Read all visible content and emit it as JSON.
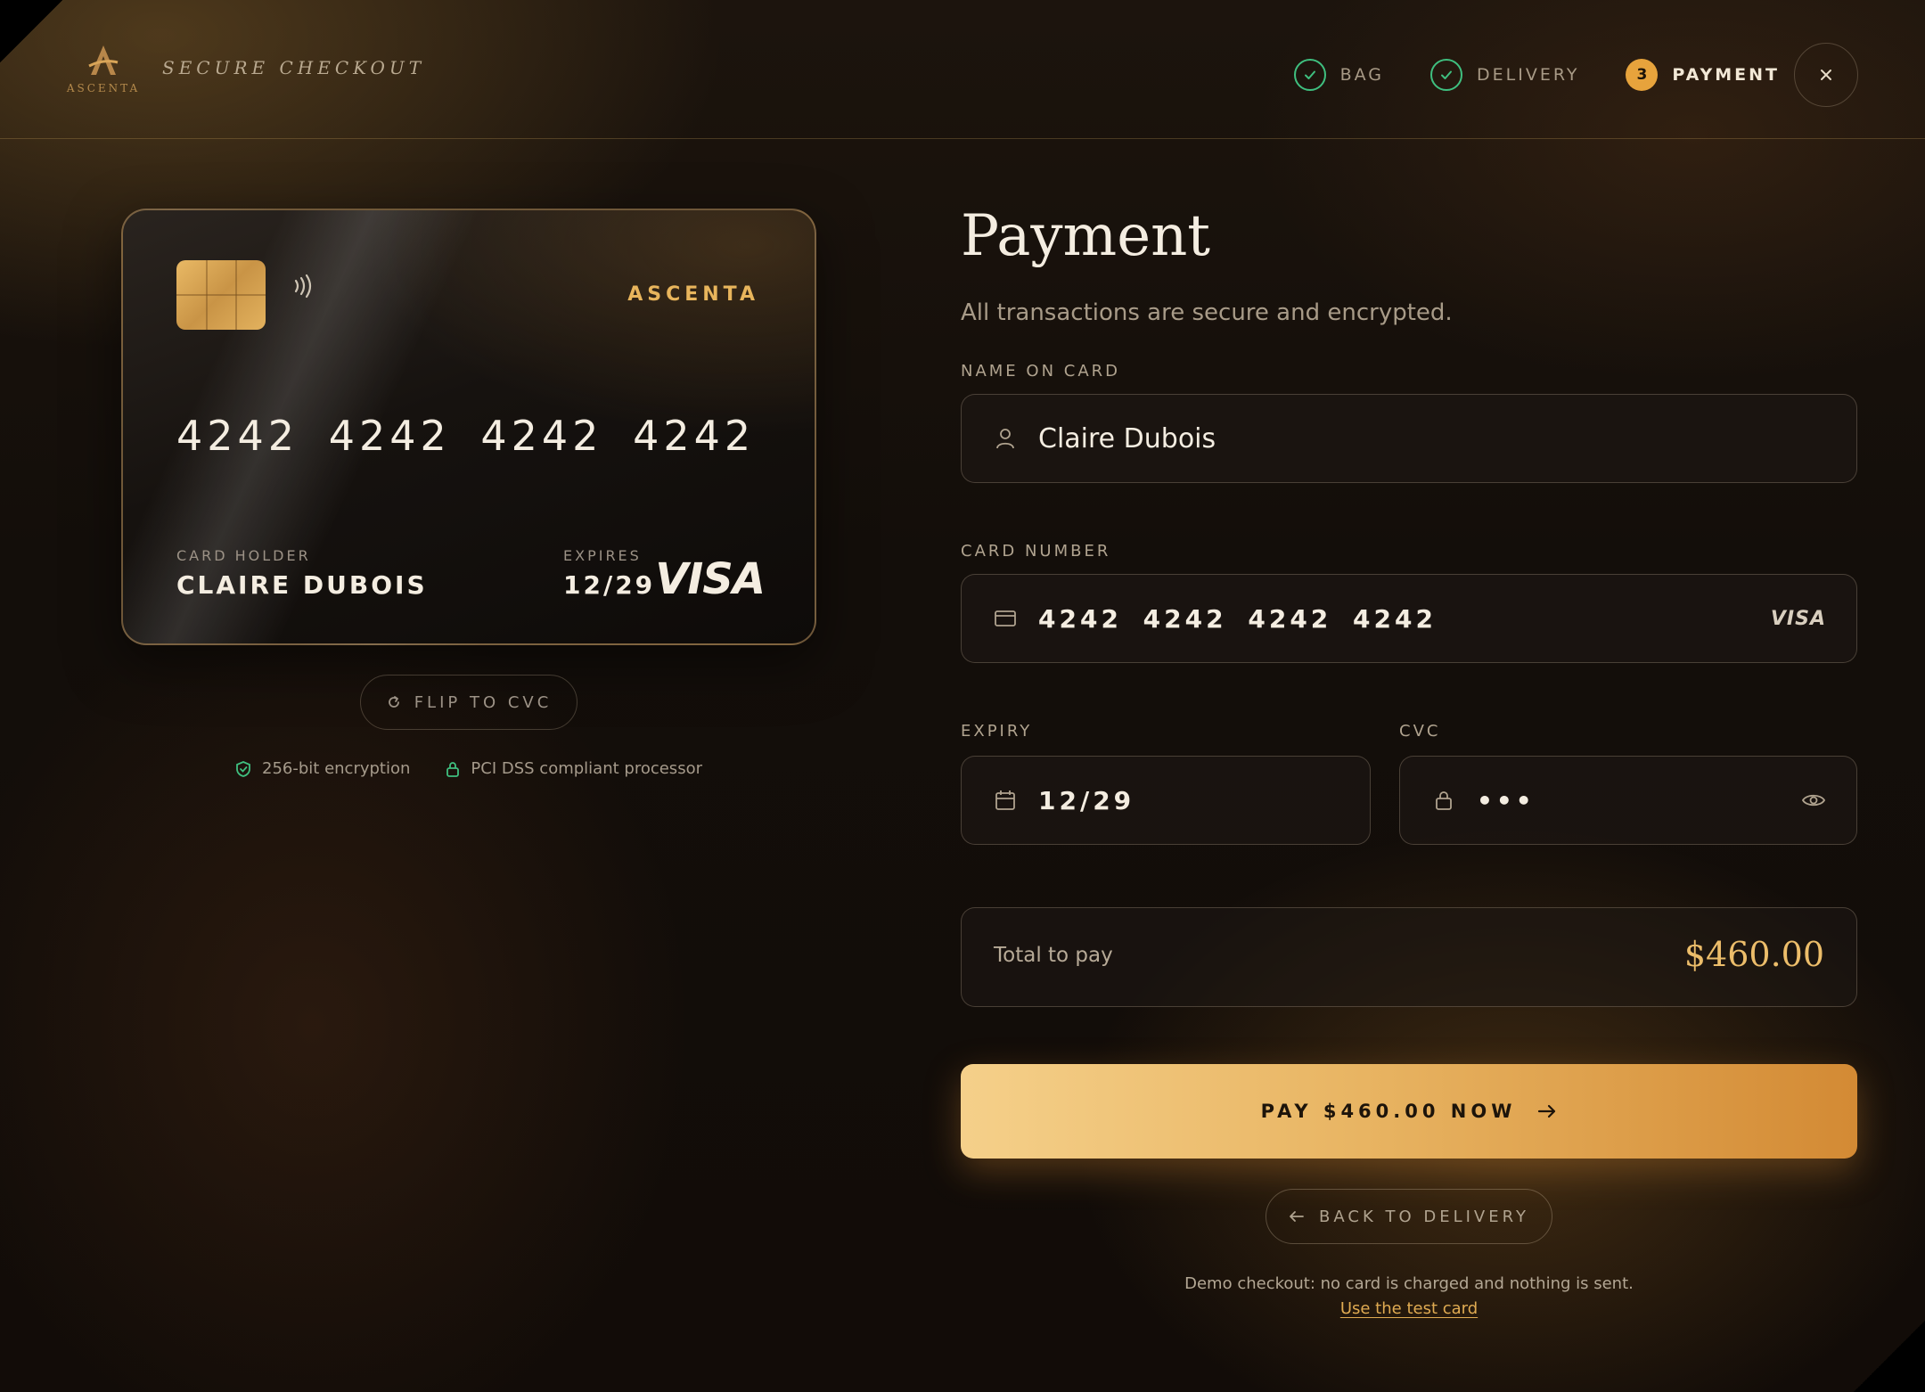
{
  "header": {
    "logo_word": "ASCENTA",
    "title": "SECURE CHECKOUT",
    "steps": [
      {
        "label": "BAG",
        "state": "done"
      },
      {
        "label": "DELIVERY",
        "state": "done"
      },
      {
        "label": "PAYMENT",
        "state": "active",
        "number": "3"
      }
    ],
    "close_icon": "close-icon"
  },
  "card": {
    "brand": "ASCENTA",
    "number": "4242 4242 4242 4242",
    "holder_label": "CARD HOLDER",
    "holder": "CLAIRE DUBOIS",
    "expires_label": "EXPIRES",
    "expires": "12/29",
    "network": "VISA"
  },
  "flip_button": "FLIP TO CVC",
  "trust": {
    "encryption": "256-bit encryption",
    "pci": "PCI DSS compliant processor"
  },
  "form": {
    "title": "Payment",
    "subtitle": "All transactions are secure and encrypted.",
    "name_label": "NAME ON CARD",
    "name_value": "Claire Dubois",
    "number_label": "CARD NUMBER",
    "number_value": "4242 4242 4242 4242",
    "number_network": "VISA",
    "expiry_label": "EXPIRY",
    "expiry_value": "12/29",
    "cvc_label": "CVC",
    "cvc_value": "•••"
  },
  "total": {
    "label": "Total to pay",
    "amount": "$460.00"
  },
  "pay_button": "PAY $460.00 NOW",
  "back_button": "BACK TO DELIVERY",
  "footer": {
    "note": "Demo checkout: no card is charged and nothing is sent.",
    "link": "Use the test card"
  },
  "colors": {
    "accent": "#e8b462",
    "success": "#3fbf7f",
    "background": "#130e0a"
  }
}
